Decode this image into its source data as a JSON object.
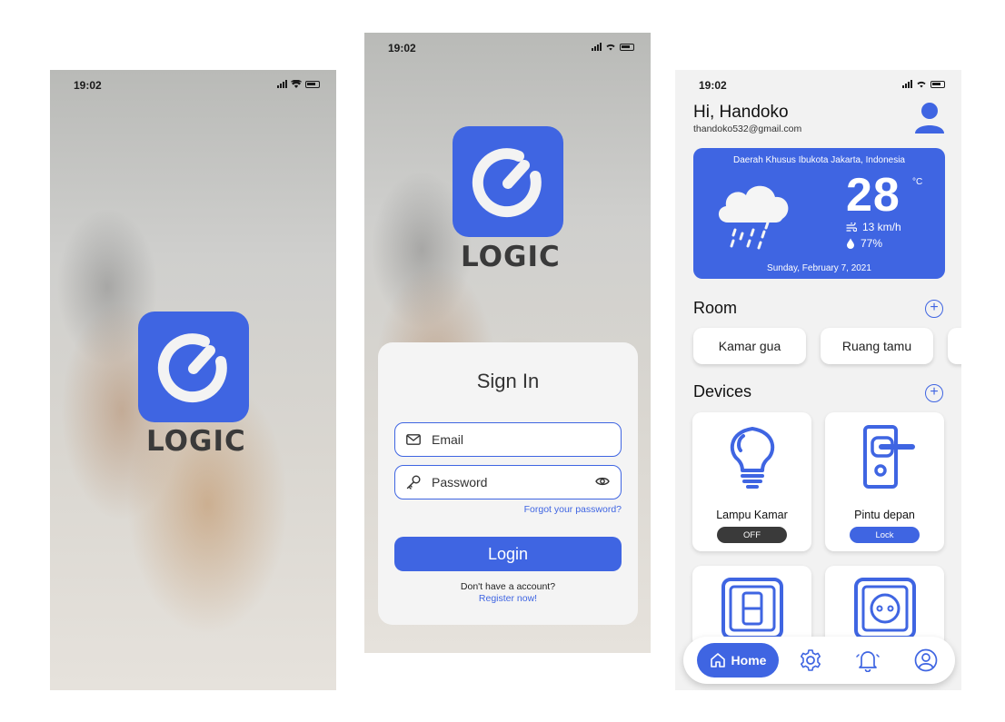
{
  "status_bar": {
    "time": "19:02"
  },
  "brand": {
    "name": "LOGIC",
    "color": "#3f65e2"
  },
  "signin": {
    "title": "Sign In",
    "email_placeholder": "Email",
    "password_placeholder": "Password",
    "forgot": "Forgot your password?",
    "login": "Login",
    "no_account": "Don't have a account?",
    "register": "Register now!"
  },
  "dashboard": {
    "greeting": "Hi, Handoko",
    "email": "thandoko532@gmail.com",
    "weather": {
      "location": "Daerah Khusus Ibukota Jakarta, Indonesia",
      "temperature": "28",
      "unit": "°C",
      "wind": "13 km/h",
      "humidity": "77%",
      "date": "Sunday, February 7, 2021",
      "condition_icon": "rain-cloud-icon"
    },
    "rooms_title": "Room",
    "rooms": [
      "Kamar gua",
      "Ruang tamu"
    ],
    "devices_title": "Devices",
    "devices": [
      {
        "name": "Lampu Kamar",
        "state": "OFF",
        "state_color": "#3a3a3a",
        "icon": "light-bulb-icon"
      },
      {
        "name": "Pintu depan",
        "state": "Lock",
        "state_color": "#3f65e2",
        "icon": "door-lock-icon"
      },
      {
        "icon": "wall-switch-icon"
      },
      {
        "icon": "power-socket-icon"
      }
    ],
    "nav": {
      "home": "Home"
    }
  }
}
